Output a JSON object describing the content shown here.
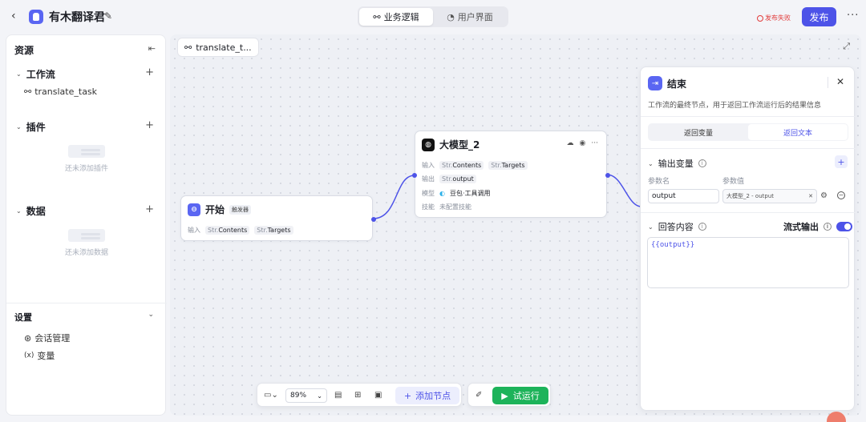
{
  "header": {
    "back_icon": "chevron-left-icon",
    "app_title": "有木翻译君",
    "view_tabs": [
      {
        "label": "业务逻辑",
        "active": true
      },
      {
        "label": "用户界面",
        "active": false
      }
    ],
    "publish_status": "发布失败",
    "publish_label": "发布",
    "more_label": "···"
  },
  "sidebar": {
    "title": "资源",
    "workflow": {
      "label": "工作流",
      "items": [
        "translate_task"
      ]
    },
    "plugin": {
      "label": "插件",
      "empty_text": "还未添加插件"
    },
    "data": {
      "label": "数据",
      "empty_text": "还未添加数据"
    },
    "settings": {
      "label": "设置",
      "items": [
        {
          "icon": "chat-manage-icon",
          "label": "会话管理"
        },
        {
          "icon": "variable-icon",
          "label": "变量"
        }
      ]
    }
  },
  "canvas": {
    "tab_label": "translate_t...",
    "start_node": {
      "title": "开始",
      "badge": "触发器",
      "input_label": "输入",
      "inputs": [
        {
          "type": "Str.",
          "name": "Contents"
        },
        {
          "type": "Str.",
          "name": "Targets"
        }
      ]
    },
    "llm_node": {
      "title": "大模型_2",
      "input_label": "输入",
      "inputs": [
        {
          "type": "Str.",
          "name": "Contents"
        },
        {
          "type": "Str.",
          "name": "Targets"
        }
      ],
      "output_label": "输出",
      "outputs": [
        {
          "type": "Str.",
          "name": "output"
        }
      ],
      "model_label": "模型",
      "model_value": "豆包·工具调用",
      "skill_label": "技能",
      "skill_value": "未配置技能"
    }
  },
  "end_panel": {
    "title": "结束",
    "description": "工作流的最终节点，用于返回工作流运行后的结果信息",
    "modes": [
      {
        "label": "返回变量",
        "active": false
      },
      {
        "label": "返回文本",
        "active": true
      }
    ],
    "output_section": "输出变量",
    "param_name_label": "参数名",
    "param_value_label": "参数值",
    "param_name": "output",
    "param_ref": "大模型_2 - output",
    "answer_section": "回答内容",
    "stream_label": "流式输出",
    "stream_on": true,
    "answer_text": "{{output}}"
  },
  "toolbar": {
    "zoom": "89%",
    "add_node_label": "添加节点",
    "run_label": "试运行"
  },
  "colors": {
    "accent": "#4d53e8",
    "run_green": "#1db35a",
    "error": "#e23b3b"
  }
}
